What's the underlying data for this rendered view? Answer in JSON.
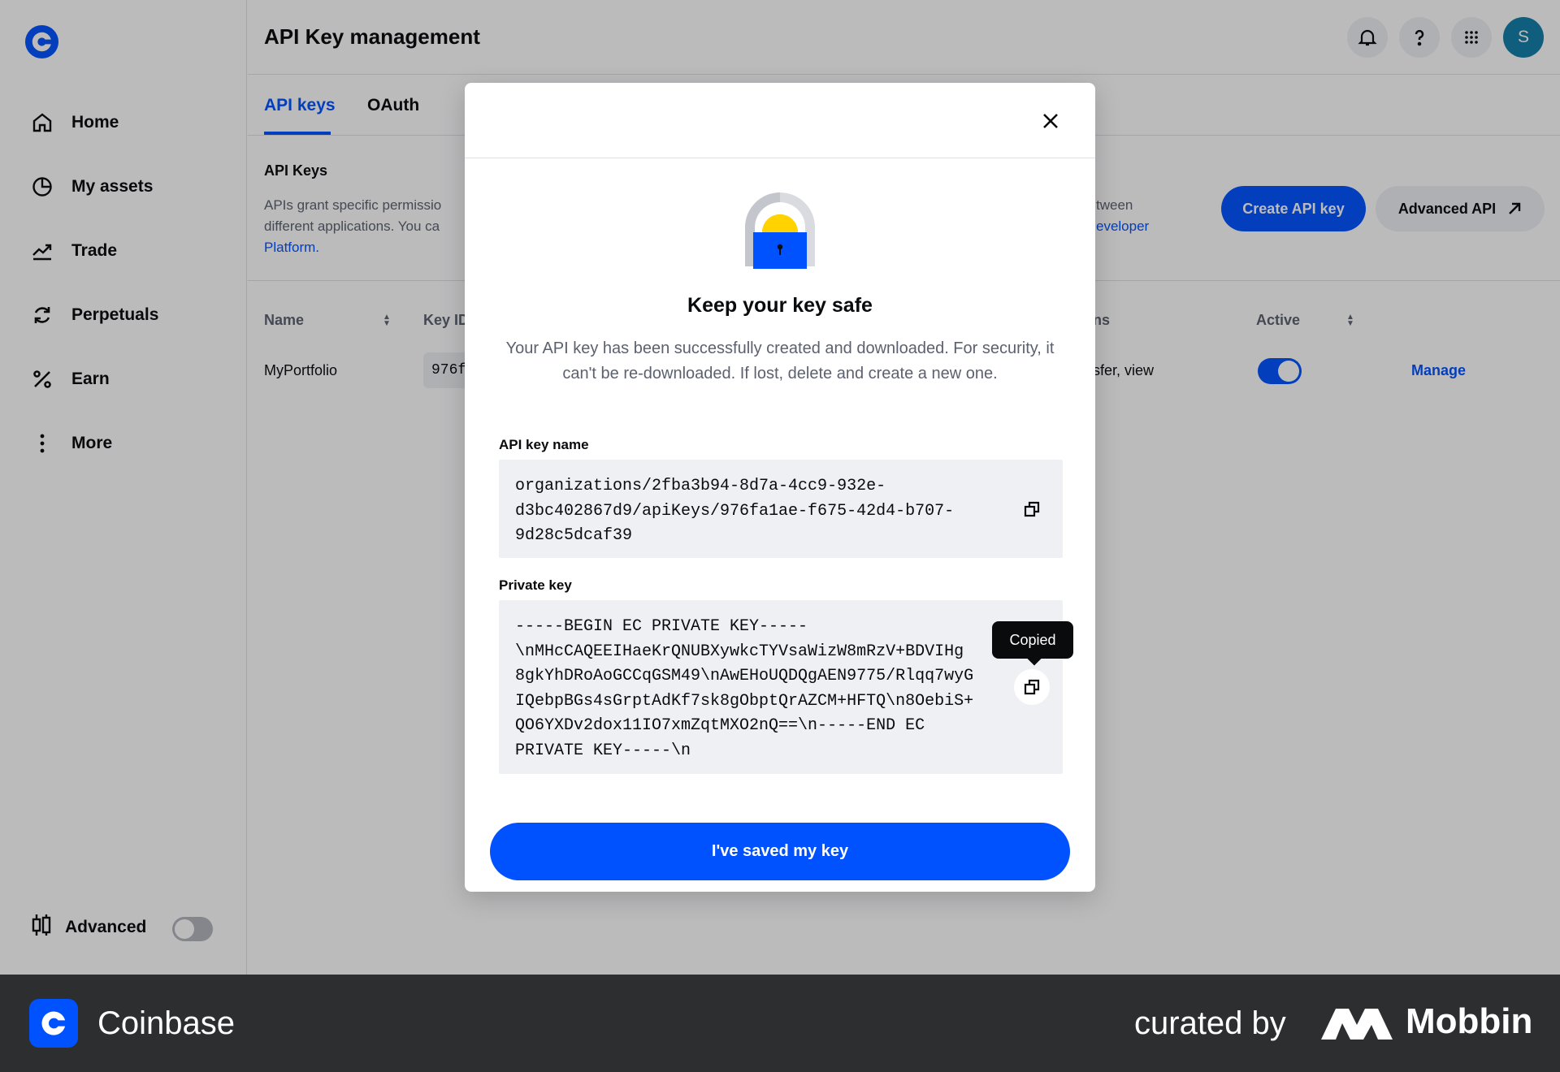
{
  "header": {
    "title": "API Key management",
    "avatar_initial": "S"
  },
  "sidebar": {
    "items": [
      {
        "label": "Home",
        "icon": "home-icon"
      },
      {
        "label": "My assets",
        "icon": "pie-chart-icon"
      },
      {
        "label": "Trade",
        "icon": "trend-chart-icon"
      },
      {
        "label": "Perpetuals",
        "icon": "refresh-icon"
      },
      {
        "label": "Earn",
        "icon": "percent-icon"
      },
      {
        "label": "More",
        "icon": "vertical-dots-icon"
      }
    ],
    "advanced_label": "Advanced",
    "advanced_enabled": false
  },
  "tabs": [
    {
      "label": "API keys",
      "active": true
    },
    {
      "label": "OAuth",
      "active": false
    }
  ],
  "section": {
    "title": "API Keys",
    "desc_line1": "APIs grant specific permissio",
    "desc_line2": "different applications. You ca",
    "desc_link": "Platform.",
    "desc_right_line1": "tween",
    "desc_right_link": "eveloper",
    "create_button": "Create API key",
    "advanced_button": "Advanced API"
  },
  "table": {
    "headers": {
      "name": "Name",
      "key_id": "Key ID",
      "permissions": "ns",
      "active": "Active"
    },
    "rows": [
      {
        "name": "MyPortfolio",
        "key_id": "976f",
        "permissions": "sfer, view",
        "active": true,
        "action": "Manage"
      }
    ]
  },
  "modal": {
    "title": "Keep your key safe",
    "description": "Your API key has been successfully created and downloaded. For security, it can't be re-downloaded. If lost, delete and create a new one.",
    "api_key_name_label": "API key name",
    "api_key_name_value": "organizations/2fba3b94-8d7a-4cc9-932e-\nd3bc402867d9/apiKeys/976fa1ae-f675-42d4-b707-\n9d28c5dcaf39",
    "private_key_label": "Private key",
    "private_key_value": "-----BEGIN EC PRIVATE KEY-----\n\\nMHcCAQEEIHaeKrQNUBXywkcTYVsaWizW8mRzV+BDVIHg\n8gkYhDRoAoGCCqGSM49\\nAwEHoUQDQgAEN9775/Rlqq7wyG\nIQebpBGs4sGrptAdKf7sk8gObptQrAZCM+HFTQ\\n8OebiS+\nQO6YXDv2dox11IO7xmZqtMXO2nQ==\\n-----END EC\nPRIVATE KEY-----\\n",
    "tooltip": "Copied",
    "confirm_button": "I've saved my key"
  },
  "footer": {
    "brand": "Coinbase",
    "curated_by": "curated by",
    "mobbin": "Mobbin"
  },
  "colors": {
    "accent": "#0052ff",
    "overlay": "rgba(10,11,13,0.28)",
    "footer_bg": "#2d2e30"
  }
}
